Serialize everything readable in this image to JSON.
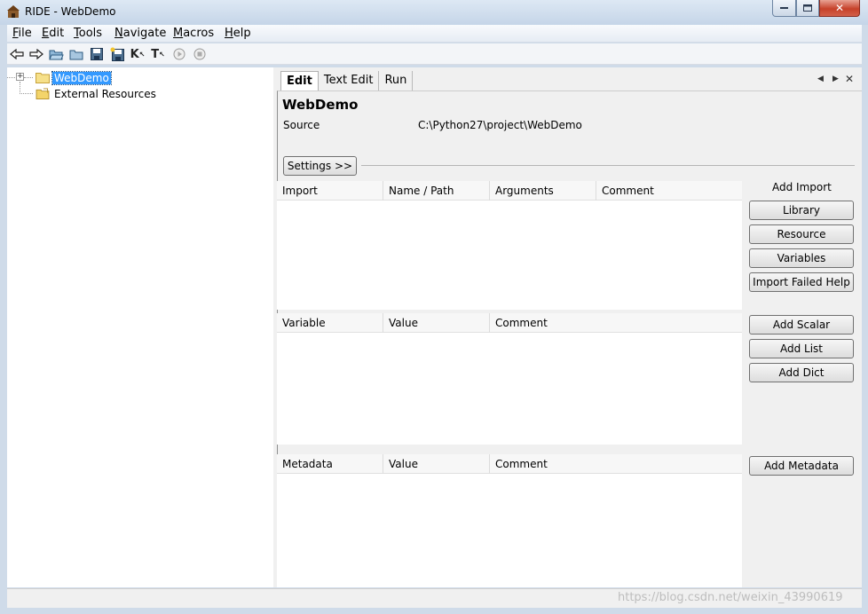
{
  "window": {
    "title": "RIDE - WebDemo"
  },
  "menu": [
    {
      "label": "File",
      "key": "F",
      "rest": "ile"
    },
    {
      "label": "Edit",
      "key": "E",
      "rest": "dit"
    },
    {
      "label": "Tools",
      "key": "T",
      "rest": "ools"
    },
    {
      "label": "Navigate",
      "key": "N",
      "rest": "avigate"
    },
    {
      "label": "Macros",
      "key": "M",
      "rest": "acros"
    },
    {
      "label": "Help",
      "key": "H",
      "rest": "elp"
    }
  ],
  "toolbar": {
    "search_keywords_label": "K",
    "search_tests_label": "T"
  },
  "tree": {
    "items": [
      {
        "label": "WebDemo",
        "selected": true
      },
      {
        "label": "External Resources",
        "selected": false
      }
    ]
  },
  "tabs": [
    {
      "label": "Edit",
      "active": true
    },
    {
      "label": "Text Edit",
      "active": false
    },
    {
      "label": "Run",
      "active": false
    }
  ],
  "editor": {
    "title": "WebDemo",
    "source_label": "Source",
    "source_value": "C:\\Python27\\project\\WebDemo",
    "settings_button": "Settings >>"
  },
  "import_table": {
    "columns": [
      "Import",
      "Name / Path",
      "Arguments",
      "Comment"
    ],
    "rows": []
  },
  "variable_table": {
    "columns": [
      "Variable",
      "Value",
      "Comment"
    ],
    "rows": []
  },
  "metadata_table": {
    "columns": [
      "Metadata",
      "Value",
      "Comment"
    ],
    "rows": []
  },
  "side_panel": {
    "add_import_label": "Add Import",
    "library_button": "Library",
    "resource_button": "Resource",
    "variables_button": "Variables",
    "import_failed_help_button": "Import Failed Help",
    "add_scalar_button": "Add Scalar",
    "add_list_button": "Add List",
    "add_dict_button": "Add Dict",
    "add_metadata_button": "Add Metadata"
  },
  "watermark": "https://blog.csdn.net/weixin_43990619"
}
